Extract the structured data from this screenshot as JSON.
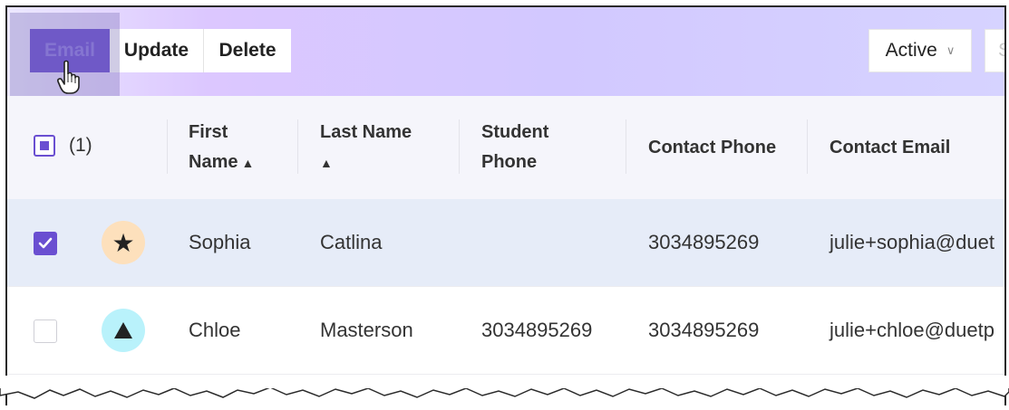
{
  "toolbar": {
    "email_label": "Email",
    "update_label": "Update",
    "delete_label": "Delete",
    "status_filter": "Active",
    "partial_button": "S"
  },
  "table": {
    "select_count": "(1)",
    "headers": {
      "first_name": [
        "First",
        "Name"
      ],
      "last_name": [
        "Last Name",
        ""
      ],
      "student_phone": [
        "Student",
        "Phone"
      ],
      "contact_phone": "Contact Phone",
      "contact_email": "Contact Email"
    },
    "rows": [
      {
        "checked": true,
        "avatar_icon": "star-icon",
        "avatar_color": "#fde0bc",
        "first_name": "Sophia",
        "last_name": "Catlina",
        "student_phone": "",
        "contact_phone": "3034895269",
        "contact_email": "julie+sophia@duet"
      },
      {
        "checked": false,
        "avatar_icon": "triangle-icon",
        "avatar_color": "#b9f2fb",
        "first_name": "Chloe",
        "last_name": "Masterson",
        "student_phone": "3034895269",
        "contact_phone": "3034895269",
        "contact_email": "julie+chloe@duetp"
      }
    ]
  },
  "colors": {
    "accent": "#6a4fd1",
    "selected_row": "#e6ecf8",
    "header_bg": "#f5f5fb"
  }
}
